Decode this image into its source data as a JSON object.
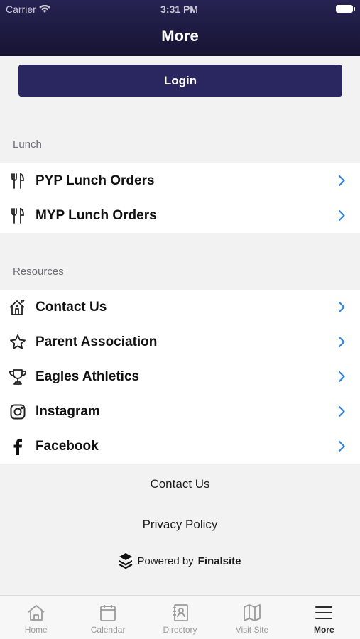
{
  "status_bar": {
    "carrier": "Carrier",
    "time": "3:31 PM"
  },
  "header": {
    "title": "More"
  },
  "login": {
    "label": "Login"
  },
  "sections": {
    "lunch": {
      "title": "Lunch",
      "items": [
        {
          "label": "PYP Lunch Orders",
          "icon": "utensils-icon"
        },
        {
          "label": "MYP Lunch Orders",
          "icon": "utensils-icon"
        }
      ]
    },
    "resources": {
      "title": "Resources",
      "items": [
        {
          "label": "Contact Us",
          "icon": "house-icon"
        },
        {
          "label": "Parent Association",
          "icon": "star-icon"
        },
        {
          "label": "Eagles Athletics",
          "icon": "trophy-icon"
        },
        {
          "label": "Instagram",
          "icon": "instagram-icon"
        },
        {
          "label": "Facebook",
          "icon": "facebook-icon"
        }
      ]
    }
  },
  "footer": {
    "contact": "Contact Us",
    "privacy": "Privacy Policy",
    "powered_prefix": "Powered by",
    "powered_brand": "Finalsite"
  },
  "tabbar": {
    "items": [
      {
        "label": "Home",
        "icon": "home-icon"
      },
      {
        "label": "Calendar",
        "icon": "calendar-icon"
      },
      {
        "label": "Directory",
        "icon": "directory-icon"
      },
      {
        "label": "Visit Site",
        "icon": "map-icon"
      },
      {
        "label": "More",
        "icon": "menu-icon",
        "active": true
      }
    ]
  },
  "colors": {
    "header": "#1c1a40",
    "accent": "#2a2660",
    "chevron": "#2f86de"
  }
}
